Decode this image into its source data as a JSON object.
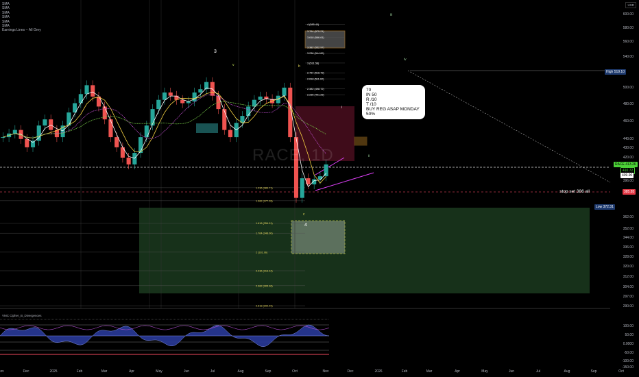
{
  "legend": {
    "items": [
      "SMA",
      "SMA",
      "SMA",
      "SMA",
      "SMA",
      "SMA",
      "Earnings Lines -- All Grey"
    ]
  },
  "currency": "USD",
  "watermark": "RACE, 1D",
  "price_axis": {
    "labels": [
      "600.00",
      "580.00",
      "560.00",
      "540.00",
      "500.00",
      "480.00",
      "460.00",
      "440.00",
      "430.00",
      "420.00",
      "396.00",
      "362.00",
      "352.00",
      "344.00",
      "336.00",
      "328.00",
      "320.00",
      "312.00",
      "304.00",
      "297.00",
      "290.00"
    ],
    "values": [
      600,
      580,
      560,
      540,
      500,
      480,
      460,
      440,
      430,
      420,
      396,
      362,
      352,
      344,
      336,
      328,
      320,
      312,
      304,
      297,
      290
    ]
  },
  "tags": {
    "symbol": "RACE",
    "last": "413.26",
    "t2": "410.72",
    "t3": "409.90",
    "high_label": "High",
    "high": "519.10",
    "low_label": "Low",
    "low": "372.31",
    "stop_price": "385.85"
  },
  "stop_text": "stop set 386 all",
  "note": {
    "lines": [
      "70",
      "IN 50",
      "R /10",
      "T /10",
      "BUY REG ASAP MONDAY 50%"
    ]
  },
  "waves": {
    "w3": "3",
    "w4": "4",
    "v": "v",
    "b": "b",
    "c": "c",
    "i": "i",
    "ii": "ii",
    "iii": "iii",
    "iv": "iv"
  },
  "fibs": [
    {
      "label": "4 (585.40)",
      "price": 585.4
    },
    {
      "label": "3.764 (575.21)",
      "price": 575.21
    },
    {
      "label": "3.618 (566.61)",
      "price": 566.61
    },
    {
      "label": "3.382 (552.97)",
      "price": 552.97
    },
    {
      "label": "3.236 (544.89)",
      "price": 544.89
    },
    {
      "label": "3 (531.58)",
      "price": 531.58
    },
    {
      "label": "2.764 (518.78)",
      "price": 518.78
    },
    {
      "label": "2.618 (511.02)",
      "price": 511.02
    },
    {
      "label": "2.382 (498.72)",
      "price": 498.72
    },
    {
      "label": "2.236 (491.26)",
      "price": 491.26
    },
    {
      "label": "1.236 (389.71)",
      "price": 389.71
    },
    {
      "label": "1.382 (377.28)",
      "price": 377.28
    },
    {
      "label": "1.618 (356.91)",
      "price": 356.91
    },
    {
      "label": "1.764 (348.00)",
      "price": 348.0
    },
    {
      "label": "2 (331.96)",
      "price": 331.96
    },
    {
      "label": "2.236 (316.94)",
      "price": 316.94
    },
    {
      "label": "2.382 (305.36)",
      "price": 305.36
    },
    {
      "label": "2.618 (290.49)",
      "price": 290.49
    }
  ],
  "oscillator": {
    "title": "VMC Cipher_B_Divergences",
    "axis": [
      "100.00",
      "50.00",
      "0.0000",
      "-50.00",
      "-100.00",
      "-150.00"
    ]
  },
  "time_axis": [
    "ov",
    "Dec",
    "2025",
    "Feb",
    "Mar",
    "Apr",
    "May",
    "Jun",
    "Jul",
    "Aug",
    "Sep",
    "Oct",
    "Nov",
    "Dec",
    "2026",
    "Feb",
    "Mar",
    "Apr",
    "May",
    "Jun",
    "Jul",
    "Aug",
    "Sep",
    "Oct"
  ],
  "colors": {
    "up": "#26a69a",
    "down": "#ef5350",
    "zone": "#1b3a1e",
    "accent": "#2962ff"
  },
  "chart_data": {
    "type": "candlestick",
    "scale": "log",
    "ylim": [
      290,
      600
    ],
    "closes": [
      442,
      446,
      450,
      440,
      431,
      438,
      455,
      462,
      450,
      442,
      455,
      470,
      481,
      492,
      503,
      489,
      477,
      462,
      442,
      431,
      420,
      413,
      425,
      442,
      455,
      474,
      485,
      494,
      490,
      485,
      481,
      483,
      494,
      498,
      507,
      490,
      474,
      450,
      442,
      458,
      466,
      477,
      485,
      489,
      486,
      481,
      490,
      500,
      442,
      380,
      399,
      393,
      398,
      401,
      413
    ]
  }
}
